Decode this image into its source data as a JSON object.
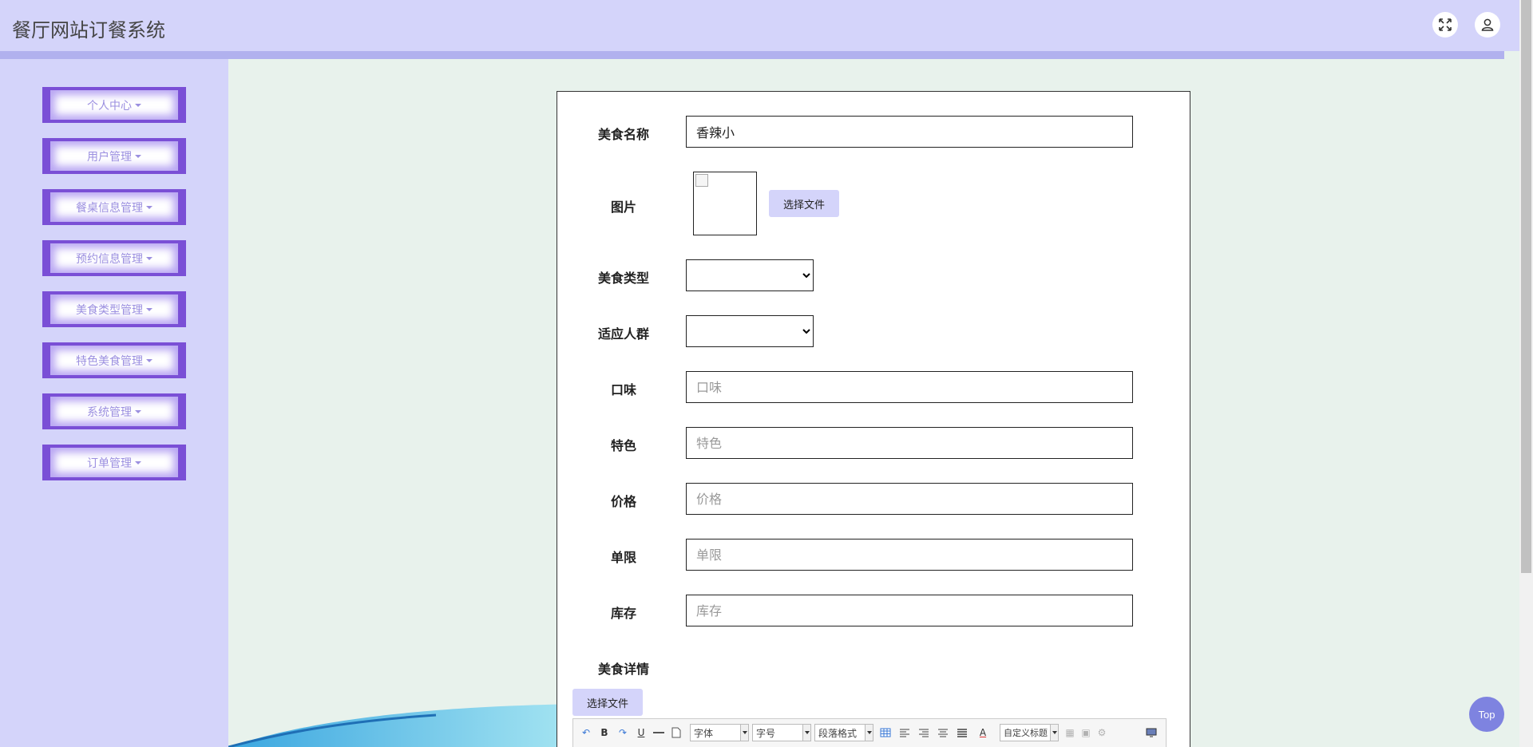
{
  "header": {
    "title": "餐厅网站订餐系统",
    "fullscreen_icon": "fullscreen-icon",
    "user_icon": "user-icon"
  },
  "sidebar": {
    "items": [
      {
        "label": "个人中心"
      },
      {
        "label": "用户管理"
      },
      {
        "label": "餐桌信息管理"
      },
      {
        "label": "预约信息管理"
      },
      {
        "label": "美食类型管理"
      },
      {
        "label": "特色美食管理"
      },
      {
        "label": "系统管理"
      },
      {
        "label": "订单管理"
      }
    ]
  },
  "form": {
    "name": {
      "label": "美食名称",
      "value": "香辣小"
    },
    "image": {
      "label": "图片",
      "button": "选择文件"
    },
    "type": {
      "label": "美食类型",
      "value": ""
    },
    "audience": {
      "label": "适应人群",
      "value": ""
    },
    "taste": {
      "label": "口味",
      "placeholder": "口味"
    },
    "feature": {
      "label": "特色",
      "placeholder": "特色"
    },
    "price": {
      "label": "价格",
      "placeholder": "价格"
    },
    "limit": {
      "label": "单限",
      "placeholder": "单限"
    },
    "stock": {
      "label": "库存",
      "placeholder": "库存"
    },
    "detail": {
      "label": "美食详情",
      "button": "选择文件"
    }
  },
  "editor_toolbar": {
    "font_family": "字体",
    "font_size": "字号",
    "paragraph": "段落格式",
    "custom_title": "自定义标题",
    "bold": "B",
    "underline": "U",
    "font_color": "A"
  },
  "top_button": "Top",
  "colors": {
    "header_bg": "#d4d4fa",
    "sidebar_accent": "#7a4fd6",
    "content_bg": "#e8f2ec",
    "top_button": "#7e83e0"
  }
}
